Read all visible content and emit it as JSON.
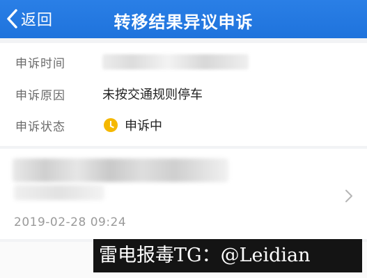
{
  "nav": {
    "back_label": "返回",
    "title": "转移结果异议申诉"
  },
  "details": {
    "time_label": "申诉时间",
    "reason_label": "申诉原因",
    "reason_value": "未按交通规则停车",
    "status_label": "申诉状态",
    "status_value": "申诉中",
    "status_color": "#f5b800"
  },
  "record": {
    "datetime": "2019-02-28 09:24"
  },
  "watermark": "雷电报毒TG：@Leidian",
  "colors": {
    "nav_bg": "#1f73dc",
    "status": "#f5b800"
  }
}
